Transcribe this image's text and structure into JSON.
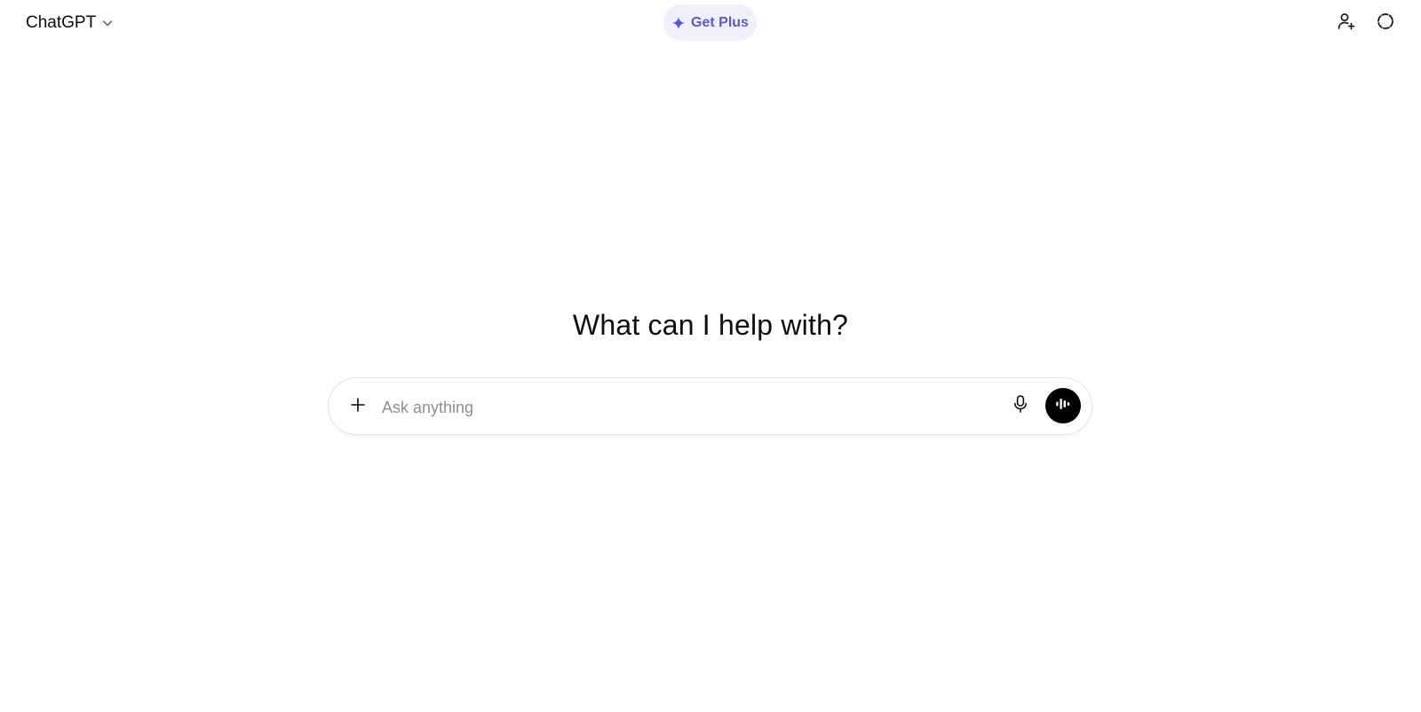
{
  "header": {
    "model_name": "ChatGPT",
    "model_menu_icon": "chevron-down-icon",
    "get_plus": {
      "label": "Get Plus",
      "icon": "sparkle-icon",
      "accent_color": "#5e5ac2",
      "background_color": "#f0f0fd"
    },
    "actions": [
      {
        "name": "add-person",
        "icon": "add-person-icon"
      },
      {
        "name": "temporary-chat",
        "icon": "dashed-circle-icon"
      }
    ]
  },
  "main": {
    "heading": "What can I help with?",
    "composer": {
      "placeholder": "Ask anything",
      "value": "",
      "add_icon": "plus-icon",
      "mic_icon": "microphone-icon",
      "voice_icon": "voice-mode-icon"
    }
  }
}
